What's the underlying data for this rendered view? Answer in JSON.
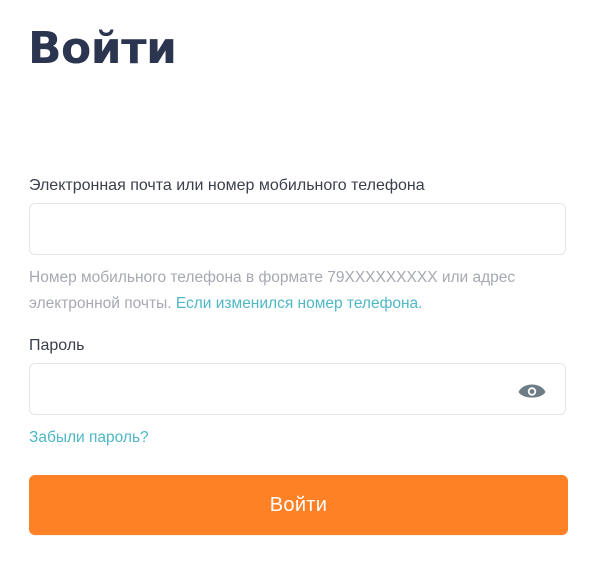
{
  "page": {
    "title": "Войти"
  },
  "form": {
    "email": {
      "label": "Электронная почта или номер мобильного телефона",
      "value": "",
      "placeholder": ""
    },
    "hint": {
      "text": "Номер мобильного телефона в формате 79XXXXXXXXX или адрес электронной почты.",
      "link": "Если изменился номер телефона."
    },
    "password": {
      "label": "Пароль",
      "value": "",
      "placeholder": "",
      "toggle_icon": "eye-icon"
    },
    "forgot_password": "Забыли пароль?",
    "submit_label": "Войти"
  },
  "colors": {
    "title": "#2c3550",
    "accent_link": "#4fb7c6",
    "button": "#ff8126",
    "hint": "#a6a9b1",
    "border": "#e3e5ea"
  }
}
